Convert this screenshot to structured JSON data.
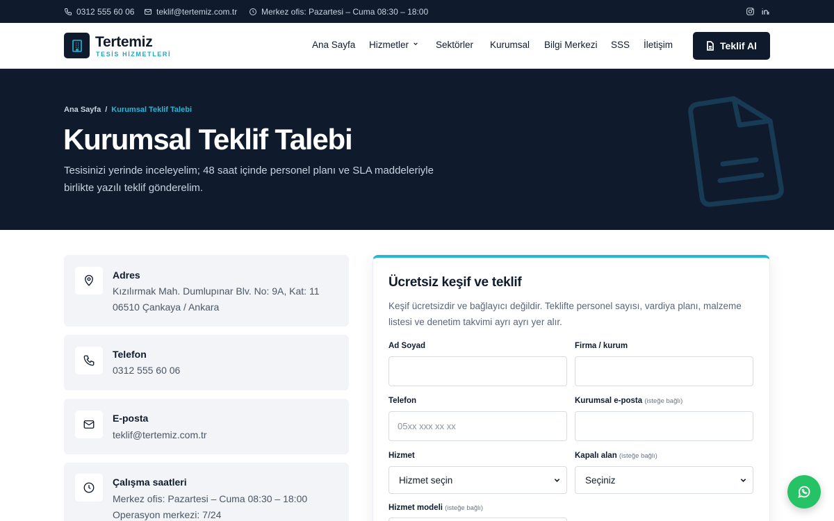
{
  "topbar": {
    "phone": "0312 555 60 06",
    "email": "teklif@tertemiz.com.tr",
    "hours": "Merkez ofis: Pazartesi – Cuma 08:30 – 18:00",
    "social_icons": [
      "instagram-icon",
      "linkedin-icon"
    ]
  },
  "brand": {
    "name": "Tertemiz",
    "tagline": "TESİS HİZMETLERİ"
  },
  "nav": {
    "items": [
      "Ana Sayfa",
      "Hizmetler",
      "Sektörler",
      "Kurumsal",
      "Bilgi Merkezi",
      "SSS",
      "İletişim"
    ],
    "cta": "Teklif Al"
  },
  "hero": {
    "breadcrumb_home": "Ana Sayfa",
    "breadcrumb_sep": "/",
    "breadcrumb_current": "Kurumsal Teklif Talebi",
    "title": "Kurumsal Teklif Talebi",
    "description": "Tesisinizi yerinde inceleyelim; 48 saat içinde personel planı ve SLA maddeleriyle birlikte yazılı teklif gönderelim."
  },
  "contact": {
    "address_title": "Adres",
    "address_line1": "Kızılırmak Mah. Dumlupınar Blv. No: 9A, Kat: 11",
    "address_line2": "06510 Çankaya / Ankara",
    "phone_title": "Telefon",
    "phone_value": "0312 555 60 06",
    "email_title": "E-posta",
    "email_value": "teklif@tertemiz.com.tr",
    "hours_title": "Çalışma saatleri",
    "hours_line1": "Merkez ofis: Pazartesi – Cuma 08:30 – 18:00",
    "hours_line2": "Operasyon merkezi: 7/24"
  },
  "form": {
    "title": "Ücretsiz keşif ve teklif",
    "lead": "Keşif ücretsizdir ve bağlayıcı değildir. Teklifte personel sayısı, vardiya planı, malzeme listesi ve denetim takvimi ayrı ayrı yer alır.",
    "optional": "(isteğe bağlı)",
    "name_label": "Ad Soyad",
    "company_label": "Firma / kurum",
    "phone_label": "Telefon",
    "phone_placeholder": "05xx xxx xx xx",
    "email_label": "Kurumsal e-posta",
    "service_label": "Hizmet",
    "service_value": "Hizmet seçin",
    "area_label": "Kapalı alan",
    "area_value": "Seçiniz",
    "model_label": "Hizmet modeli"
  },
  "colors": {
    "navy": "#0f1b2d",
    "accent": "#22b8d6",
    "whatsapp": "#25c366"
  }
}
